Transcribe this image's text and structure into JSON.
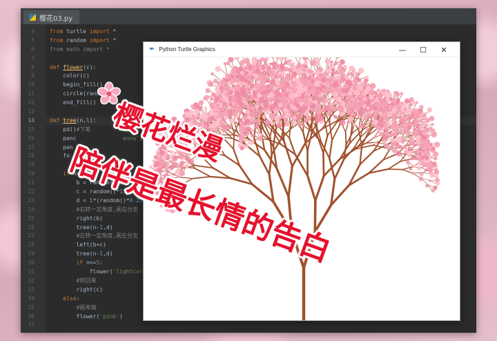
{
  "ide": {
    "tab_label": "樱花03.py",
    "code_lines": [
      {
        "num": "4",
        "html": "<span class='kw'>from</span> turtle <span class='kw'>import</span> *"
      },
      {
        "num": "5",
        "html": "<span class='kw'>from</span> random <span class='kw'>import</span> *"
      },
      {
        "num": "6",
        "html": "<span class='cm'>from math import *</span>"
      },
      {
        "num": "7",
        "html": ""
      },
      {
        "num": "8",
        "html": "<span class='kw'>def</span> <span class='fn'>flower</span>(c):"
      },
      {
        "num": "9",
        "html": "    color(c)"
      },
      {
        "num": "10",
        "html": "    begin_fill()"
      },
      {
        "num": "11",
        "html": "    circle(rand"
      },
      {
        "num": "12",
        "html": "    end_fill()"
      },
      {
        "num": "13",
        "html": ""
      },
      {
        "num": "14",
        "html": "<span class='kw'>def</span> <span class='fn'>tree</span>(n,l):"
      },
      {
        "num": "15",
        "html": "    pd()<span class='cm'>#下笔</span>"
      },
      {
        "num": "16",
        "html": "    penc              <span class='st'>enna'</span>)"
      },
      {
        "num": "17",
        "html": "    pen"
      },
      {
        "num": "18",
        "html": "    fo"
      },
      {
        "num": "19",
        "html": ""
      },
      {
        "num": "20",
        "html": "    <span class='kw'>if</span> n&gt;<span class='nb'>0</span>:"
      },
      {
        "num": "21",
        "html": "        b = random()*<span class='nb'>15</span>+"
      },
      {
        "num": "22",
        "html": "        c = random()*<span class='nb'>15</span>+<span class='nb'>10</span>"
      },
      {
        "num": "23",
        "html": "        d = l*(random()*<span class='nb'>0.25</span>+"
      },
      {
        "num": "24",
        "html": "        <span class='cm'>#右转一定角度,画右分支</span>"
      },
      {
        "num": "25",
        "html": "        right(b)"
      },
      {
        "num": "26",
        "html": "        tree(n-<span class='nb'>1</span>,d)"
      },
      {
        "num": "27",
        "html": "        <span class='cm'>#左转一定角度,画左分支</span>"
      },
      {
        "num": "28",
        "html": "        left(b+c)"
      },
      {
        "num": "29",
        "html": "        tree(n-<span class='nb'>1</span>,d)"
      },
      {
        "num": "30",
        "html": "        <span class='kw'>if</span> n&lt;=<span class='nb'>5</span>:"
      },
      {
        "num": "31",
        "html": "            flower(<span class='st'>'lightcoral</span>"
      },
      {
        "num": "32",
        "html": "        <span class='cm'>#转回来</span>"
      },
      {
        "num": "33",
        "html": "        right(c)"
      },
      {
        "num": "34",
        "html": "    <span class='kw'>else</span>:"
      },
      {
        "num": "35",
        "html": "        <span class='cm'>#画末端</span>"
      },
      {
        "num": "36",
        "html": "        flower(<span class='st'>'pink'</span>)"
      },
      {
        "num": "37",
        "html": ""
      }
    ]
  },
  "turtle_window": {
    "title": "Python Turtle Graphics",
    "minimize_glyph": "—",
    "maximize_glyph": "☐",
    "close_glyph": "✕",
    "trunk_color": "#a0522d",
    "blossom_colors": [
      "#f6a5b9",
      "#f08ca6",
      "#ffc0cb",
      "#f4a0b0"
    ]
  },
  "overlay": {
    "line1": "樱花烂漫",
    "line2": "陪伴是最长情的告白",
    "text_color": "#e5122d"
  }
}
